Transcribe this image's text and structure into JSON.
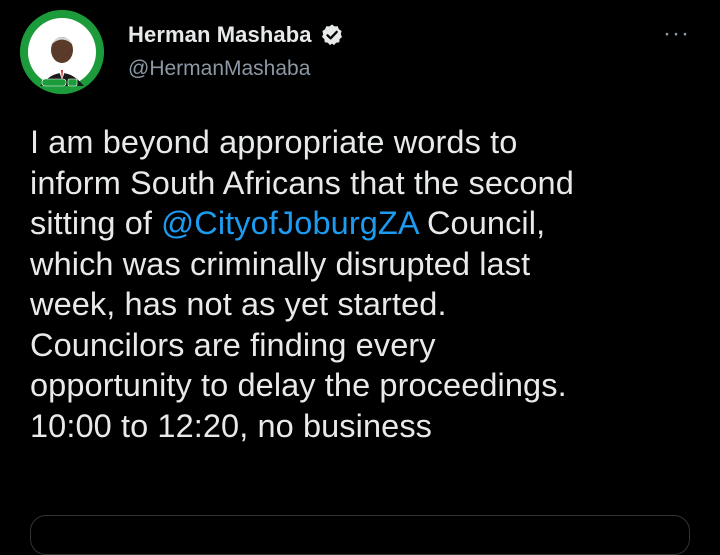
{
  "author": {
    "display_name": "Herman Mashaba",
    "handle": "@HermanMashaba",
    "verified": true,
    "avatar_badge_text": "ACTIONSA"
  },
  "menu": {
    "more_icon": "more-dots-icon",
    "more_glyph": "···"
  },
  "tweet": {
    "lines": [
      "I am beyond appropriate words to",
      "inform South Africans that the second",
      "sitting of ",
      "which was criminally disrupted last",
      "week, has not as yet started.",
      "Councilors are finding every",
      "opportunity to delay the proceedings.",
      "10:00 to 12:20, no business"
    ],
    "mention": "@CityofJoburgZA",
    "mention_suffix": " Council,"
  },
  "colors": {
    "background": "#000000",
    "text": "#e7e9ea",
    "secondary": "#8b98a5",
    "link": "#1d9bf0",
    "avatar_ring": "#1c9b3a"
  }
}
